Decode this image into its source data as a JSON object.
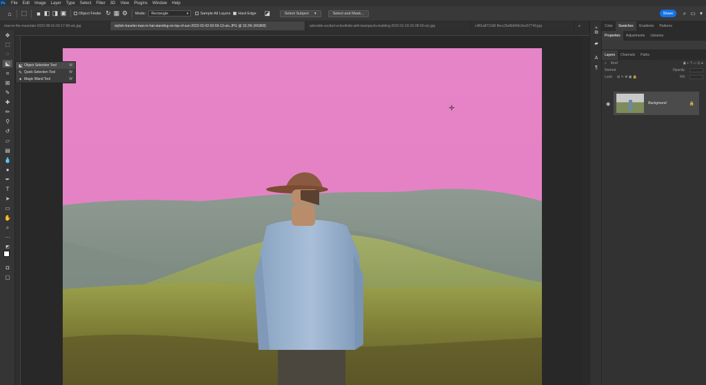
{
  "app": {
    "logo": "Ps",
    "menu": [
      "File",
      "Edit",
      "Image",
      "Layer",
      "Type",
      "Select",
      "Filter",
      "3D",
      "View",
      "Plugins",
      "Window",
      "Help"
    ]
  },
  "options": {
    "object_finder_label": "Object Finder",
    "mode_label": "Mode:",
    "mode_value": "Rectangle",
    "sample_all_layers": "Sample All Layers",
    "hard_edge": "Hard Edge",
    "select_subject": "Select Subject",
    "select_and_mask": "Select and Mask...",
    "share": "Share"
  },
  "tabs": [
    {
      "label": "man-in-the-mountain-2022-08-01-03-17-58-utc.jpg",
      "active": false
    },
    {
      "label": "stylish-traveler-man-in-hat-standing-on-top-of-sun-2022-02-02-03-59-13-utc.JPG @ 33.3% (RGB/8)",
      "active": true
    },
    {
      "label": "adorable-excited-schoolkids-with-backpacks-building-2022-01-18-23-38-59-utc.jpg",
      "active": false
    },
    {
      "label": "c481a8710d5 ffecc2bd9d046c9ce57749.jpg",
      "active": false
    }
  ],
  "flyout": {
    "items": [
      {
        "label": "Object Selection Tool",
        "key": "W"
      },
      {
        "label": "Quick Selection Tool",
        "key": "W"
      },
      {
        "label": "Magic Wand Tool",
        "key": "W"
      }
    ]
  },
  "panels": {
    "top_tabs": [
      "Color",
      "Swatches",
      "Gradients",
      "Patterns"
    ],
    "mid_tabs": [
      "Properties",
      "Adjustments",
      "Libraries"
    ],
    "layer_tabs": [
      "Layers",
      "Channels",
      "Paths"
    ],
    "layer_name": "Background",
    "kind_label": "Kind",
    "normal_label": "Normal",
    "opacity_label": "Opacity:",
    "lock_label": "Lock:",
    "fill_label": "Fill:"
  },
  "colors": {
    "accent": "#1473e6",
    "sky_mask": "#e07fc1"
  }
}
